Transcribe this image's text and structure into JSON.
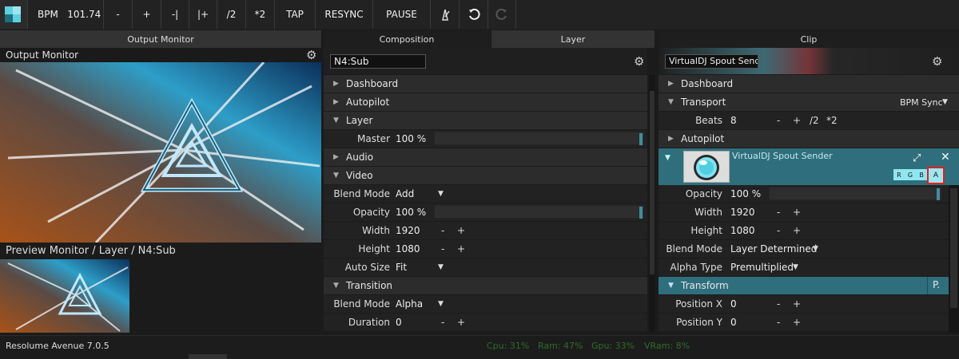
{
  "toolbar": {
    "bpm_label": "BPM",
    "bpm_value": "101.74",
    "minus": "-",
    "plus": "+",
    "nudge_back": "-|",
    "nudge_fwd": "|+",
    "half": "/2",
    "double": "*2",
    "tap": "TAP",
    "resync": "RESYNC",
    "pause": "PAUSE"
  },
  "output": {
    "tab": "Output Monitor",
    "title": "Output Monitor",
    "preview_title": "Preview Monitor / Layer / N4:Sub"
  },
  "composition": {
    "tab": "Composition",
    "layer_tab": "Layer",
    "name_value": "N4:Sub",
    "sections": {
      "dashboard": "Dashboard",
      "autopilot": "Autopilot",
      "layer": "Layer",
      "audio": "Audio",
      "video": "Video",
      "transition": "Transition"
    },
    "master": {
      "label": "Master",
      "value": "100 %"
    },
    "blend_mode": {
      "label": "Blend Mode",
      "value": "Add"
    },
    "opacity": {
      "label": "Opacity",
      "value": "100 %"
    },
    "width": {
      "label": "Width",
      "value": "1920",
      "minus": "-",
      "plus": "+"
    },
    "height": {
      "label": "Height",
      "value": "1080",
      "minus": "-",
      "plus": "+"
    },
    "auto_size": {
      "label": "Auto Size",
      "value": "Fit"
    },
    "t_blend": {
      "label": "Blend Mode",
      "value": "Alpha"
    },
    "duration": {
      "label": "Duration",
      "value": "0",
      "minus": "-",
      "plus": "+"
    }
  },
  "clip": {
    "tab": "Clip",
    "name_value": "VirtualDJ Spout Sender",
    "sections": {
      "dashboard": "Dashboard",
      "transport": "Transport",
      "autopilot": "Autopilot",
      "transform": "Transform"
    },
    "bpm_sync": "BPM Sync",
    "beats": {
      "label": "Beats",
      "value": "8",
      "minus": "-",
      "plus": "+",
      "half": "/2",
      "double": "*2"
    },
    "source_name": "VirtualDJ Spout Sender",
    "channels": [
      "R",
      "G",
      "B",
      "A"
    ],
    "opacity": {
      "label": "Opacity",
      "value": "100 %"
    },
    "width": {
      "label": "Width",
      "value": "1920",
      "minus": "-",
      "plus": "+"
    },
    "height": {
      "label": "Height",
      "value": "1080",
      "minus": "-",
      "plus": "+"
    },
    "blend_mode": {
      "label": "Blend Mode",
      "value": "Layer Determined"
    },
    "alpha_type": {
      "label": "Alpha Type",
      "value": "Premultiplied"
    },
    "transform_btn": "P.",
    "pos_x": {
      "label": "Position X",
      "value": "0",
      "minus": "-",
      "plus": "+"
    },
    "pos_y": {
      "label": "Position Y",
      "value": "0",
      "minus": "-",
      "plus": "+"
    }
  },
  "status": {
    "app": "Resolume Avenue 7.0.5",
    "cpu": "Cpu: 31%",
    "ram": "Ram: 47%",
    "gpu": "Gpu: 33%",
    "vram": "VRam: 8%"
  },
  "colors": {
    "accent": "#2f6f7d",
    "highlight_red": "#e02020"
  }
}
